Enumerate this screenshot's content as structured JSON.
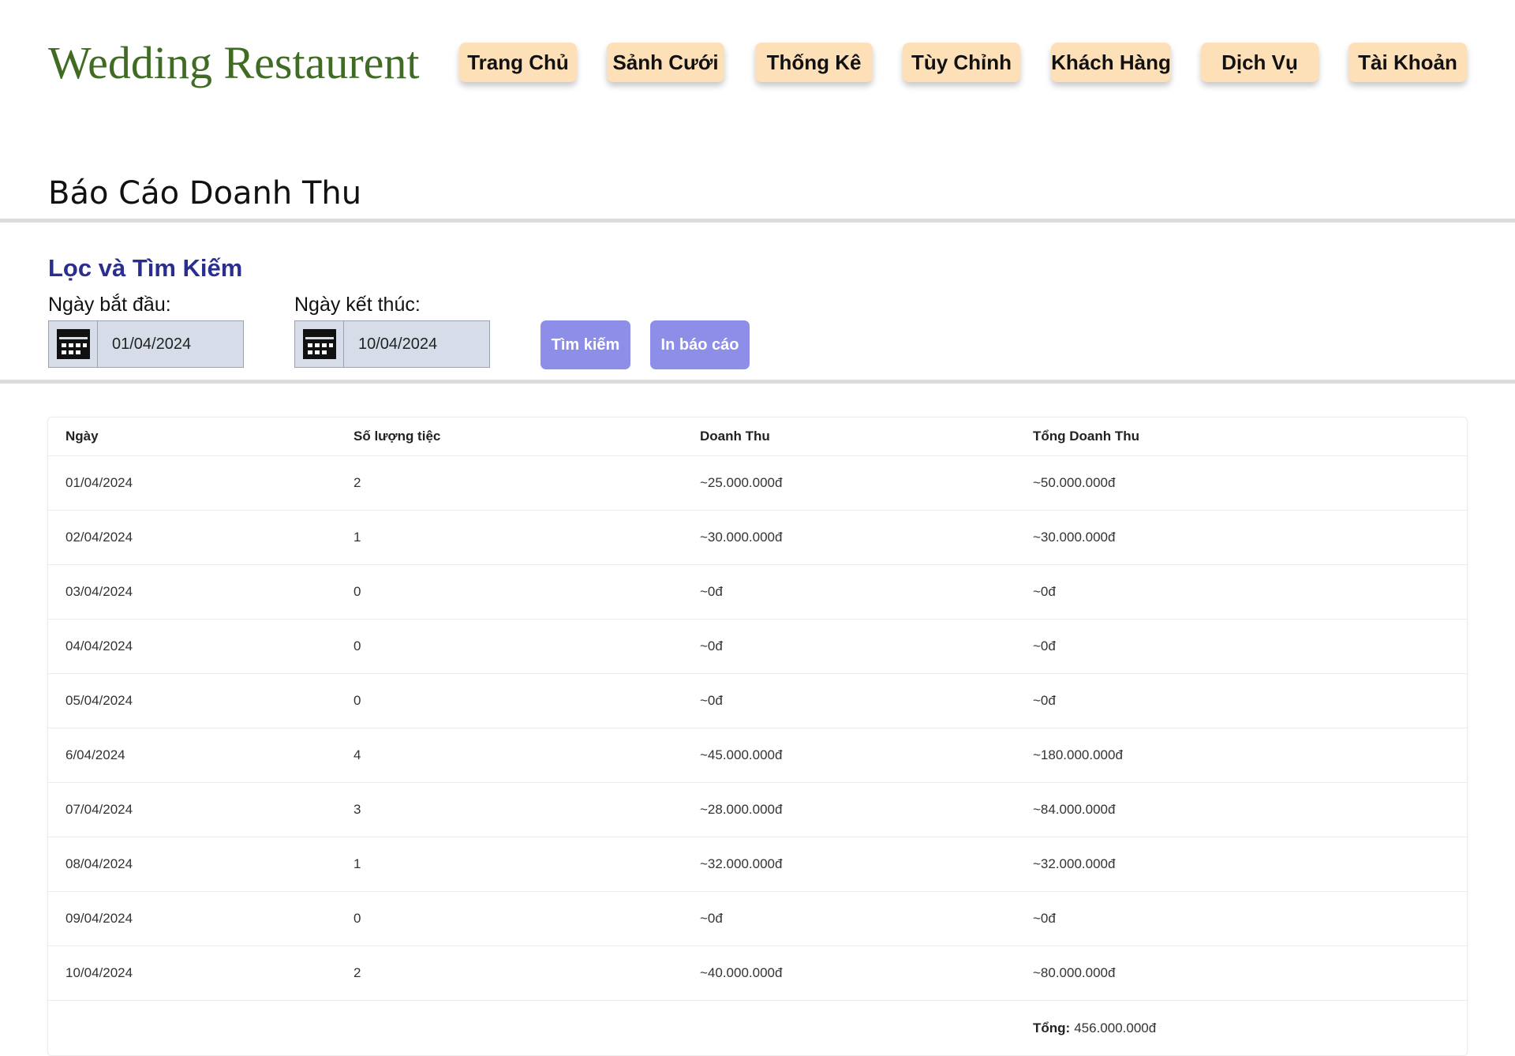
{
  "app": {
    "logo": "Wedding Restaurent"
  },
  "nav": {
    "items": [
      {
        "label": "Trang Chủ"
      },
      {
        "label": "Sảnh Cưới"
      },
      {
        "label": "Thống Kê"
      },
      {
        "label": "Tùy Chỉnh"
      },
      {
        "label": "Khách Hàng"
      },
      {
        "label": "Dịch Vụ"
      },
      {
        "label": "Tài Khoản"
      }
    ]
  },
  "page": {
    "title": "Báo Cáo Doanh Thu"
  },
  "filter": {
    "title": "Lọc và Tìm Kiếm",
    "start_label": "Ngày bắt đầu:",
    "start_value": "01/04/2024",
    "end_label": "Ngày kết thúc:",
    "end_value": "10/04/2024",
    "search_button": "Tìm kiếm",
    "print_button": "In báo cáo",
    "icon": "calendar-icon"
  },
  "table": {
    "headers": [
      "Ngày",
      "Số lượng tiệc",
      "Doanh Thu",
      "Tổng Doanh Thu"
    ],
    "rows": [
      [
        "01/04/2024",
        "2",
        "~25.000.000đ",
        "~50.000.000đ"
      ],
      [
        "02/04/2024",
        "1",
        "~30.000.000đ",
        "~30.000.000đ"
      ],
      [
        "03/04/2024",
        "0",
        "~0đ",
        "~0đ"
      ],
      [
        "04/04/2024",
        "0",
        "~0đ",
        "~0đ"
      ],
      [
        "05/04/2024",
        "0",
        "~0đ",
        "~0đ"
      ],
      [
        "6/04/2024",
        "4",
        "~45.000.000đ",
        "~180.000.000đ"
      ],
      [
        "07/04/2024",
        "3",
        "~28.000.000đ",
        "~84.000.000đ"
      ],
      [
        "08/04/2024",
        "1",
        "~32.000.000đ",
        "~32.000.000đ"
      ],
      [
        "09/04/2024",
        "0",
        "~0đ",
        "~0đ"
      ],
      [
        "10/04/2024",
        "2",
        "~40.000.000đ",
        "~80.000.000đ"
      ]
    ],
    "total_label": "Tổng:",
    "total_value": "456.000.000đ"
  },
  "colors": {
    "logo": "#3f6b23",
    "nav_button": "#fde0b8",
    "filter_title": "#2a2f8f",
    "action_button": "#8c8ee8",
    "date_field": "#d6dde9"
  }
}
